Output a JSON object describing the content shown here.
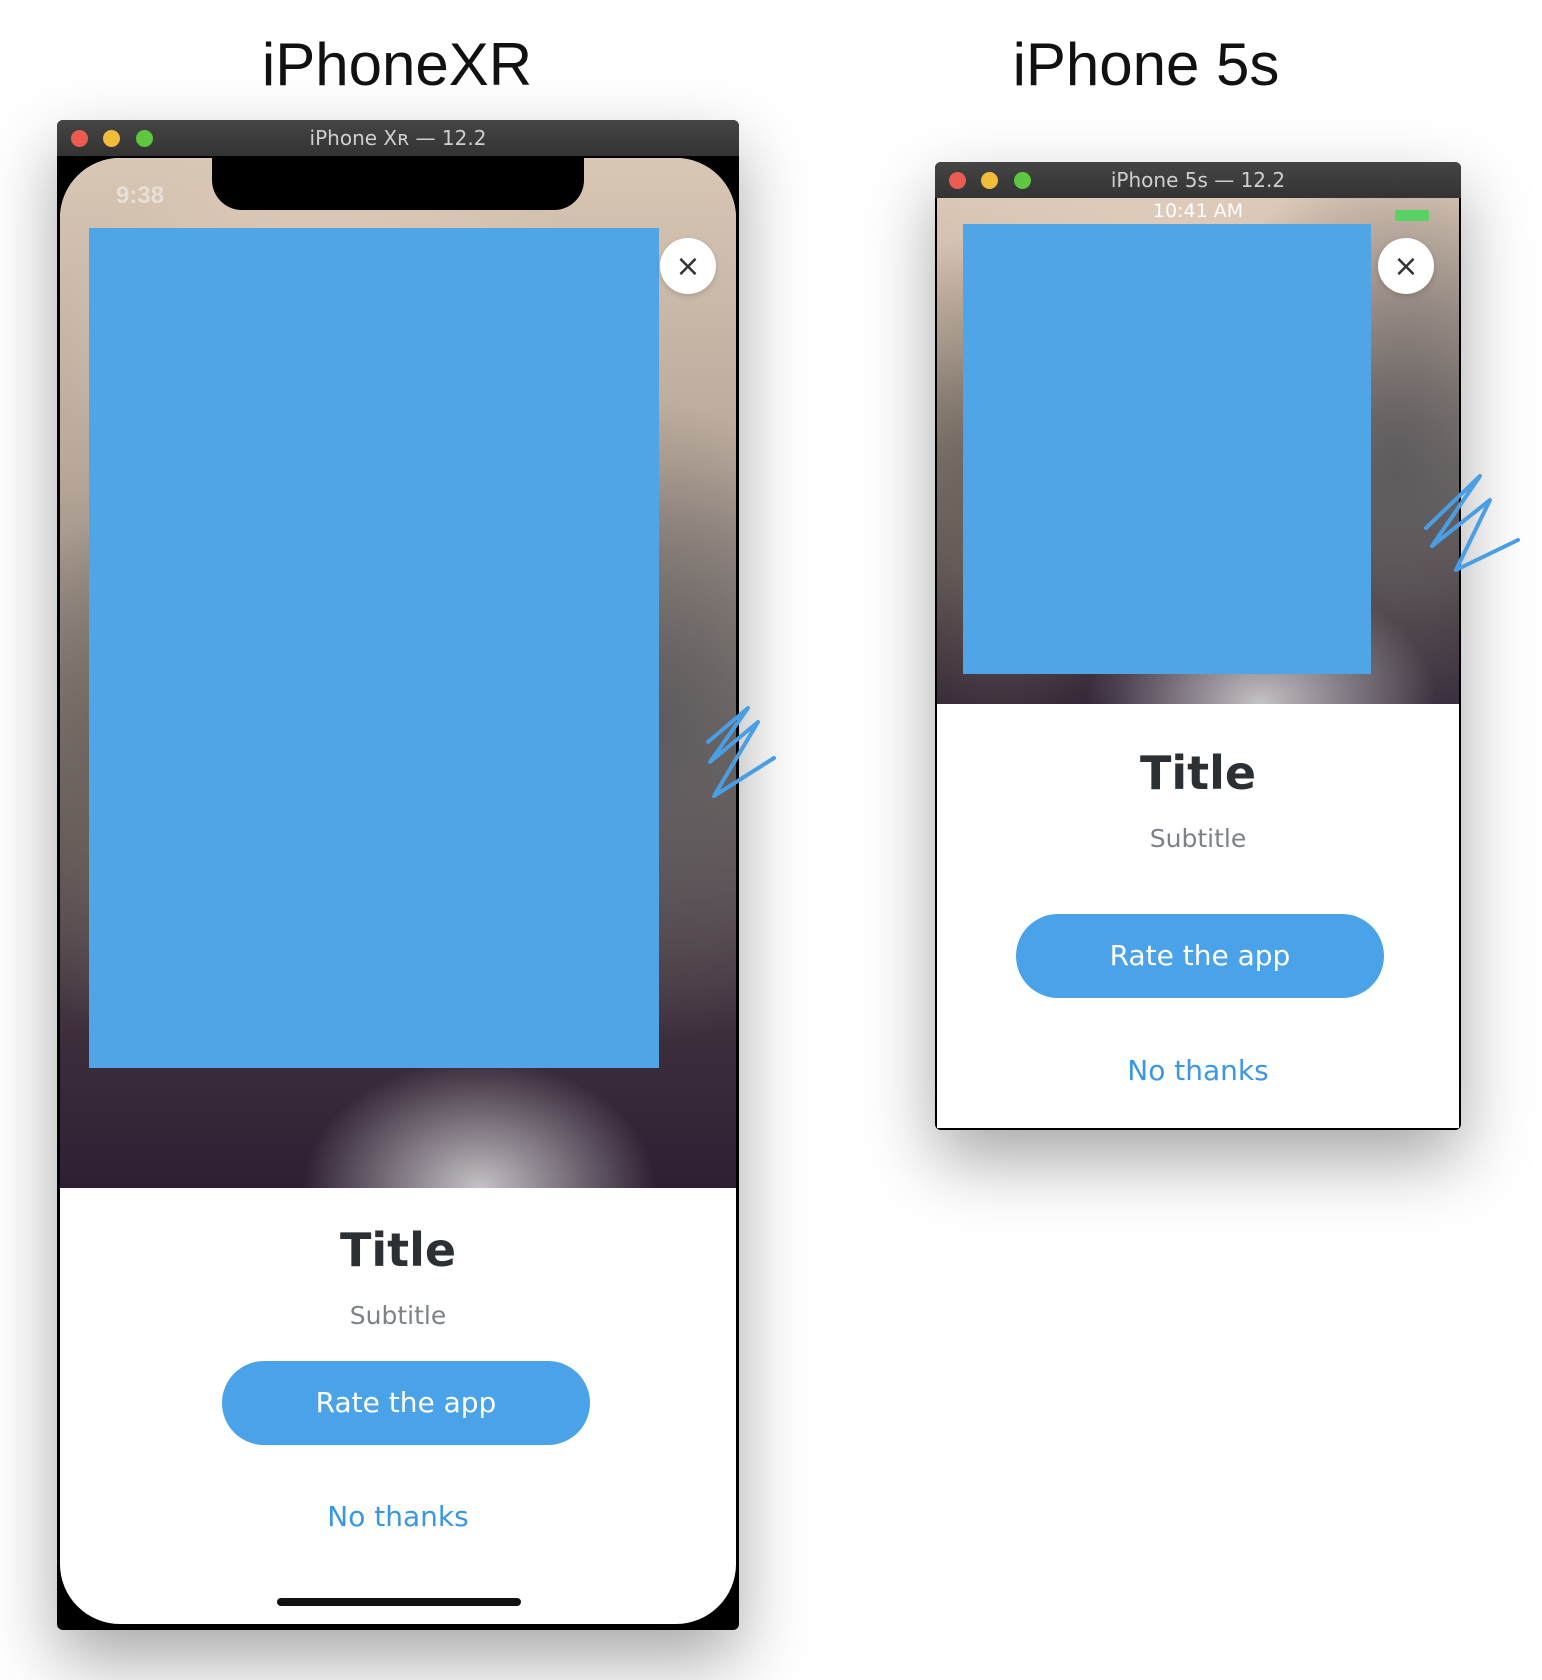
{
  "headings": {
    "xr": "iPhoneXR",
    "s5": "iPhone 5s"
  },
  "simulator_xr": {
    "window_title": "iPhone Xʀ — 12.2",
    "status_time": "9:38",
    "close_icon": "×",
    "card": {
      "title": "Title",
      "subtitle": "Subtitle",
      "rate_button": "Rate the app",
      "no_thanks": "No thanks"
    }
  },
  "simulator_5s": {
    "window_title": "iPhone 5s — 12.2",
    "status_time": "10:41 AM",
    "close_icon": "×",
    "card": {
      "title": "Title",
      "subtitle": "Subtitle",
      "rate_button": "Rate the app",
      "no_thanks": "No thanks"
    }
  },
  "colors": {
    "placeholder": "#50a5e7",
    "button": "#4aa3e8",
    "link": "#3a97e6",
    "title": "#2b3035"
  }
}
